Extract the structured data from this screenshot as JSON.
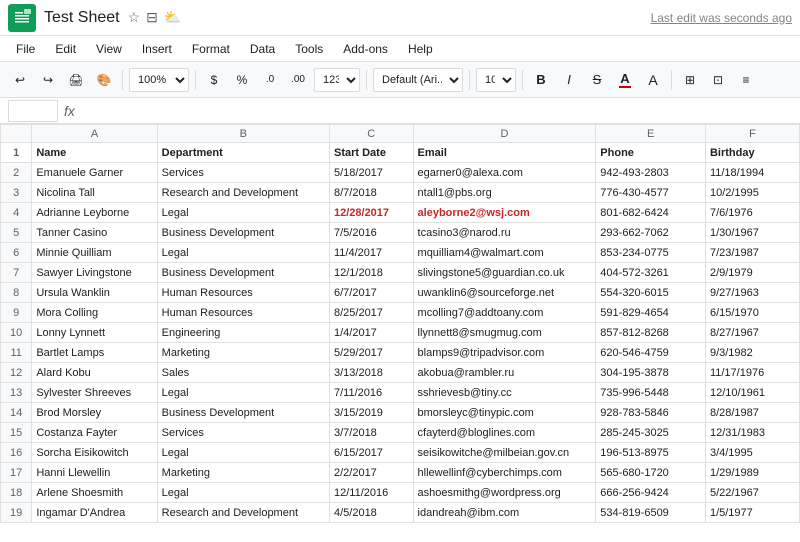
{
  "titleBar": {
    "title": "Test Sheet",
    "lastEdit": "Last edit was seconds ago",
    "starIcon": "★",
    "folderIcon": "📁",
    "driveIcon": "☁"
  },
  "menuBar": {
    "items": [
      "File",
      "Edit",
      "View",
      "Insert",
      "Format",
      "Data",
      "Tools",
      "Add-ons",
      "Help"
    ]
  },
  "toolbar": {
    "zoom": "100%",
    "currency": "$",
    "percent": "%",
    "decimal0": ".0",
    "decimal00": ".00",
    "moreFormats": "123",
    "font": "Default (Ari...",
    "fontSize": "10",
    "bold": "B",
    "italic": "I",
    "strikethrough": "S",
    "underline": "A"
  },
  "formulaBar": {
    "cellRef": "",
    "formulaText": ""
  },
  "columnHeaders": [
    "A",
    "B",
    "C",
    "D",
    "E",
    "F"
  ],
  "headers": [
    "Name",
    "Department",
    "Start Date",
    "Email",
    "Phone",
    "Birthday"
  ],
  "rows": [
    {
      "num": 2,
      "a": "Emanuele Garner",
      "b": "Services",
      "c": "5/18/2017",
      "d": "egarner0@alexa.com",
      "e": "942-493-2803",
      "f": "11/18/1994",
      "highlight": false
    },
    {
      "num": 3,
      "a": "Nicolina Tall",
      "b": "Research and Development",
      "c": "8/7/2018",
      "d": "ntall1@pbs.org",
      "e": "776-430-4577",
      "f": "10/2/1995",
      "highlight": false
    },
    {
      "num": 4,
      "a": "Adrianne Leyborne",
      "b": "Legal",
      "c": "12/28/2017",
      "d": "aleyborne2@wsj.com",
      "e": "801-682-6424",
      "f": "7/6/1976",
      "highlight": true
    },
    {
      "num": 5,
      "a": "Tanner Casino",
      "b": "Business Development",
      "c": "7/5/2016",
      "d": "tcasino3@narod.ru",
      "e": "293-662-7062",
      "f": "1/30/1967",
      "highlight": false
    },
    {
      "num": 6,
      "a": "Minnie Quilliam",
      "b": "Legal",
      "c": "11/4/2017",
      "d": "mquilliam4@walmart.com",
      "e": "853-234-0775",
      "f": "7/23/1987",
      "highlight": false
    },
    {
      "num": 7,
      "a": "Sawyer Livingstone",
      "b": "Business Development",
      "c": "12/1/2018",
      "d": "slivingstone5@guardian.co.uk",
      "e": "404-572-3261",
      "f": "2/9/1979",
      "highlight": false
    },
    {
      "num": 8,
      "a": "Ursula Wanklin",
      "b": "Human Resources",
      "c": "6/7/2017",
      "d": "uwanklin6@sourceforge.net",
      "e": "554-320-6015",
      "f": "9/27/1963",
      "highlight": false
    },
    {
      "num": 9,
      "a": "Mora Colling",
      "b": "Human Resources",
      "c": "8/25/2017",
      "d": "mcolling7@addtoany.com",
      "e": "591-829-4654",
      "f": "6/15/1970",
      "highlight": false
    },
    {
      "num": 10,
      "a": "Lonny Lynnett",
      "b": "Engineering",
      "c": "1/4/2017",
      "d": "llynnett8@smugmug.com",
      "e": "857-812-8268",
      "f": "8/27/1967",
      "highlight": false
    },
    {
      "num": 11,
      "a": "Bartlet Lamps",
      "b": "Marketing",
      "c": "5/29/2017",
      "d": "blamps9@tripadvisor.com",
      "e": "620-546-4759",
      "f": "9/3/1982",
      "highlight": false
    },
    {
      "num": 12,
      "a": "Alard Kobu",
      "b": "Sales",
      "c": "3/13/2018",
      "d": "akobua@rambler.ru",
      "e": "304-195-3878",
      "f": "11/17/1976",
      "highlight": false
    },
    {
      "num": 13,
      "a": "Sylvester Shreeves",
      "b": "Legal",
      "c": "7/11/2016",
      "d": "sshrievesb@tiny.cc",
      "e": "735-996-5448",
      "f": "12/10/1961",
      "highlight": false
    },
    {
      "num": 14,
      "a": "Brod Morsley",
      "b": "Business Development",
      "c": "3/15/2019",
      "d": "bmorsleyc@tinypic.com",
      "e": "928-783-5846",
      "f": "8/28/1987",
      "highlight": false
    },
    {
      "num": 15,
      "a": "Costanza Fayter",
      "b": "Services",
      "c": "3/7/2018",
      "d": "cfayterd@bloglines.com",
      "e": "285-245-3025",
      "f": "12/31/1983",
      "highlight": false
    },
    {
      "num": 16,
      "a": "Sorcha Eisikowitch",
      "b": "Legal",
      "c": "6/15/2017",
      "d": "seisikowitche@milbeian.gov.cn",
      "e": "196-513-8975",
      "f": "3/4/1995",
      "highlight": false
    },
    {
      "num": 17,
      "a": "Hanni Llewellin",
      "b": "Marketing",
      "c": "2/2/2017",
      "d": "hllewellinf@cyberchimps.com",
      "e": "565-680-1720",
      "f": "1/29/1989",
      "highlight": false
    },
    {
      "num": 18,
      "a": "Arlene Shoesmith",
      "b": "Legal",
      "c": "12/11/2016",
      "d": "ashoesmithg@wordpress.org",
      "e": "666-256-9424",
      "f": "5/22/1967",
      "highlight": false
    },
    {
      "num": 19,
      "a": "Ingamar D'Andrea",
      "b": "Research and Development",
      "c": "4/5/2018",
      "d": "idandreah@ibm.com",
      "e": "534-819-6509",
      "f": "1/5/1977",
      "highlight": false
    }
  ]
}
